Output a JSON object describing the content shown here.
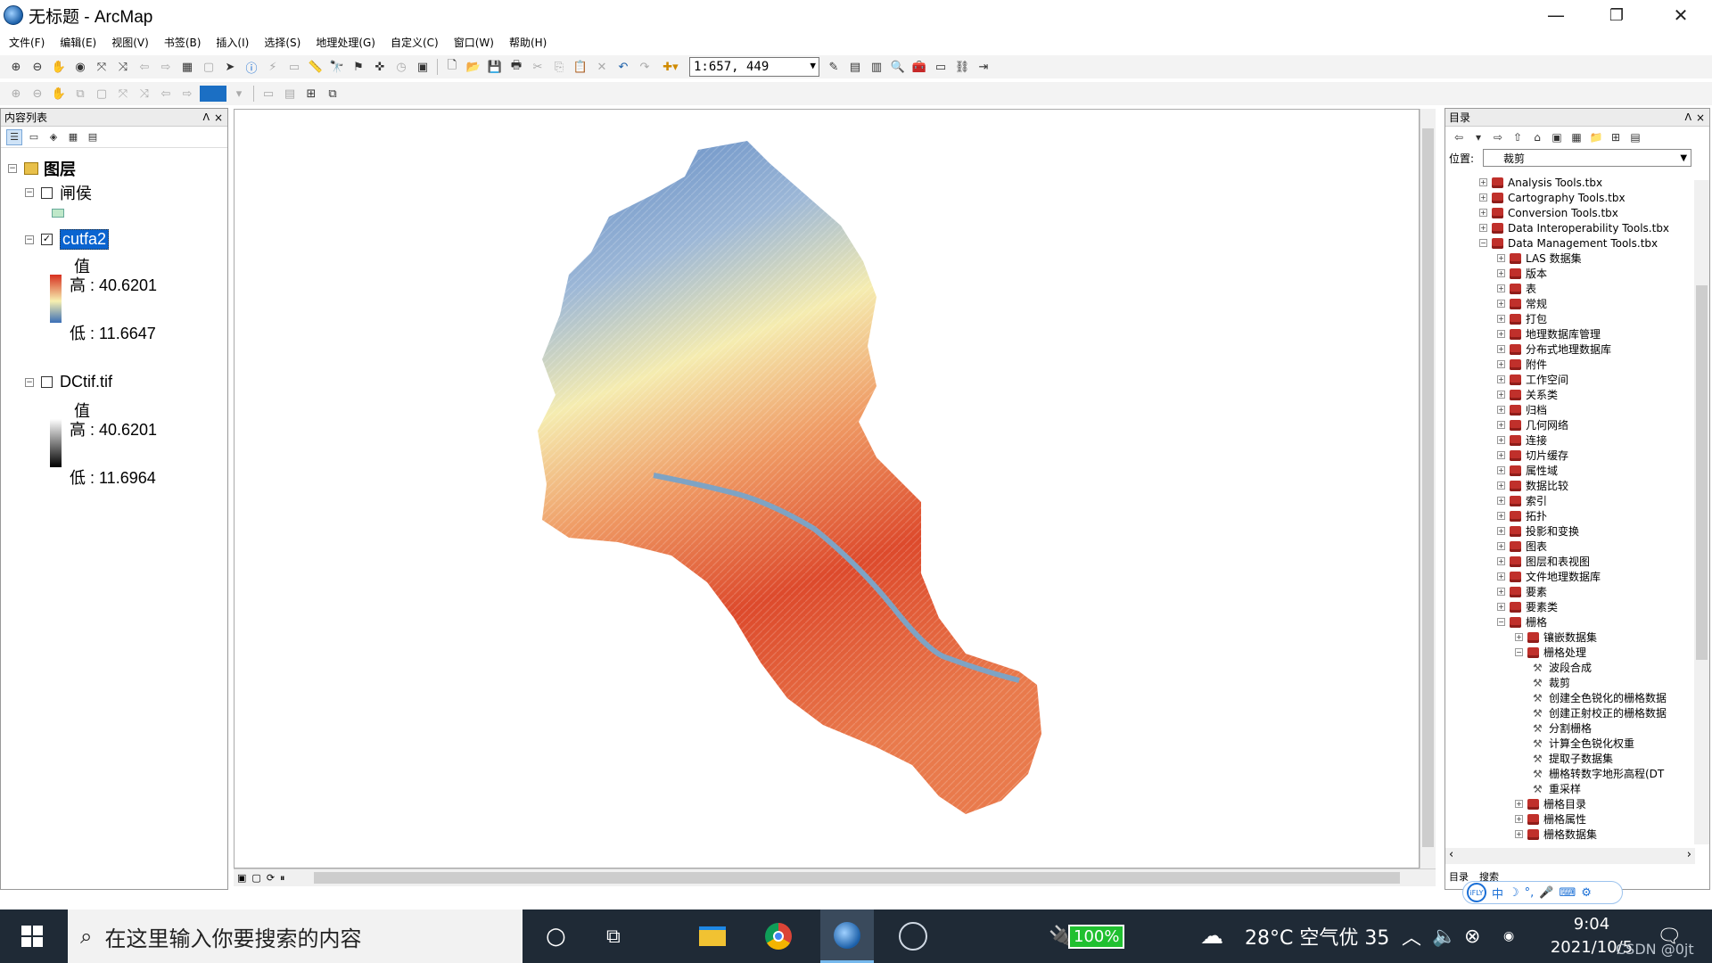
{
  "window": {
    "title": "无标题 - ArcMap",
    "minimize": "—",
    "restore": "❐",
    "close": "✕"
  },
  "menu": [
    "文件(F)",
    "编辑(E)",
    "视图(V)",
    "书签(B)",
    "插入(I)",
    "选择(S)",
    "地理处理(G)",
    "自定义(C)",
    "窗口(W)",
    "帮助(H)"
  ],
  "toolbar": {
    "scale": "1:657, 449"
  },
  "toc": {
    "title": "内容列表",
    "pin": "ᐱ",
    "close": "×",
    "root": "图层",
    "layers": [
      {
        "name": "闸侯",
        "checked": false
      },
      {
        "name": "cutfa2",
        "checked": true,
        "value_label": "值",
        "high": "高 : 40.6201",
        "low": "低 : 11.6647"
      },
      {
        "name": "DCtif.tif",
        "checked": false,
        "value_label": "值",
        "high": "高 : 40.6201",
        "low": "低 : 11.6964"
      }
    ]
  },
  "catalog": {
    "title": "目录",
    "location_label": "位置:",
    "location_value": "裁剪",
    "toolboxes": [
      "Analysis Tools.tbx",
      "Cartography Tools.tbx",
      "Conversion Tools.tbx",
      "Data Interoperability Tools.tbx",
      "Data Management Tools.tbx"
    ],
    "toolsets": [
      "LAS 数据集",
      "版本",
      "表",
      "常规",
      "打包",
      "地理数据库管理",
      "分布式地理数据库",
      "附件",
      "工作空间",
      "关系类",
      "归档",
      "几何网络",
      "连接",
      "切片缓存",
      "属性域",
      "数据比较",
      "索引",
      "拓扑",
      "投影和变换",
      "图表",
      "图层和表视图",
      "文件地理数据库",
      "要素",
      "要素类",
      "栅格"
    ],
    "raster_subsets": [
      "镶嵌数据集",
      "栅格处理"
    ],
    "raster_tools": [
      "波段合成",
      "裁剪",
      "创建全色锐化的栅格数据",
      "创建正射校正的栅格数据",
      "分割栅格",
      "计算全色锐化权重",
      "提取子数据集",
      "栅格转数字地形高程(DT",
      "重采样"
    ],
    "raster_after": [
      "栅格目录",
      "栅格属性",
      "栅格数据集"
    ],
    "bottom_tabs": [
      "目录",
      "搜索"
    ]
  },
  "ime": [
    "中",
    "☽",
    "°,",
    "🎤",
    "⌨",
    "⚙"
  ],
  "taskbar": {
    "search_placeholder": "在这里输入你要搜索的内容",
    "battery": "100%",
    "weather": "28°C 空气优 35",
    "time": "9:04",
    "date": "2021/10/5",
    "watermark": "CSDN @0jt"
  },
  "colors": {
    "ramp_high": "#d7301f",
    "ramp_mid": "#f7f0b0",
    "ramp_low": "#3b6fb6",
    "selected": "#0a64d0"
  }
}
